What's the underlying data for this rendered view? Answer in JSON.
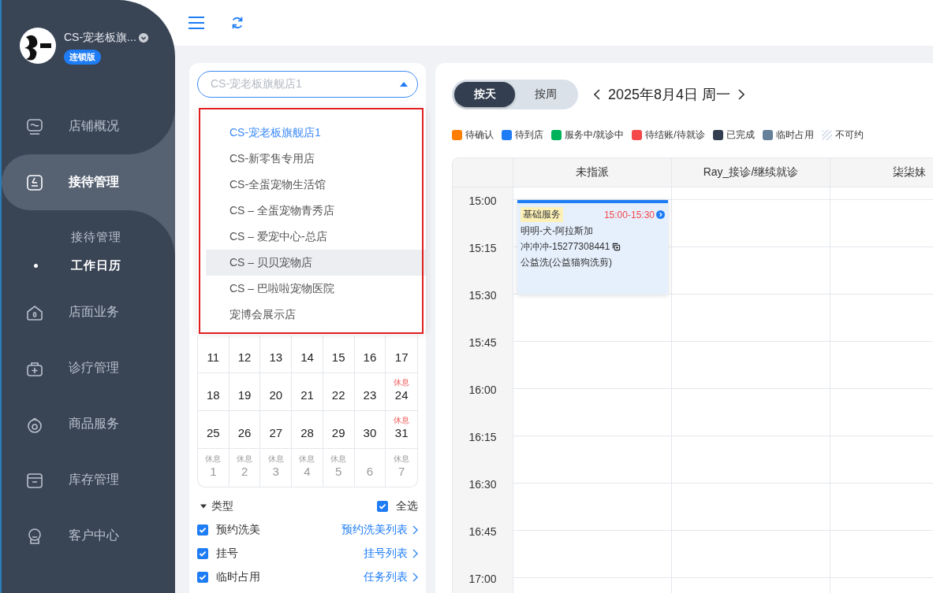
{
  "sidebar": {
    "brand": {
      "name": "CS-宠老板旗...",
      "badge": "连锁版"
    },
    "items": [
      {
        "label": "店铺概况",
        "selected": false
      },
      {
        "label": "接待管理",
        "selected": true,
        "expanded": true,
        "children": [
          {
            "label": "接待管理",
            "selected": false
          },
          {
            "label": "工作日历",
            "selected": true
          }
        ]
      },
      {
        "label": "店面业务",
        "selected": false
      },
      {
        "label": "诊疗管理",
        "selected": false
      },
      {
        "label": "商品服务",
        "selected": false
      },
      {
        "label": "库存管理",
        "selected": false
      },
      {
        "label": "客户中心",
        "selected": false
      }
    ]
  },
  "store_select": {
    "placeholder": "CS-宠老板旗舰店1",
    "open": true,
    "options": [
      {
        "label": "CS-宠老板旗舰店1",
        "selected": true,
        "hovered": false
      },
      {
        "label": "CS-新零售专用店",
        "selected": false,
        "hovered": false
      },
      {
        "label": "CS-全蛋宠物生活馆",
        "selected": false,
        "hovered": false
      },
      {
        "label": "CS – 全蛋宠物青秀店",
        "selected": false,
        "hovered": false
      },
      {
        "label": "CS – 爱宠中心-总店",
        "selected": false,
        "hovered": false
      },
      {
        "label": "CS – 贝贝宠物店",
        "selected": false,
        "hovered": true
      },
      {
        "label": "CS – 巴啦啦宠物医院",
        "selected": false,
        "hovered": false
      },
      {
        "label": "宠博会展示店",
        "selected": false,
        "hovered": false
      }
    ]
  },
  "calendar": {
    "weeks": [
      [
        {
          "day": "11",
          "muted": false
        },
        {
          "day": "12",
          "muted": false
        },
        {
          "day": "13",
          "muted": false
        },
        {
          "day": "14",
          "muted": false
        },
        {
          "day": "15",
          "muted": false
        },
        {
          "day": "16",
          "muted": false
        },
        {
          "day": "17",
          "muted": false
        }
      ],
      [
        {
          "day": "18",
          "muted": false
        },
        {
          "day": "19",
          "muted": false
        },
        {
          "day": "20",
          "muted": false
        },
        {
          "day": "21",
          "muted": false
        },
        {
          "day": "22",
          "muted": false
        },
        {
          "day": "23",
          "muted": false
        },
        {
          "day": "24",
          "muted": false,
          "note": "休息"
        }
      ],
      [
        {
          "day": "25",
          "muted": false
        },
        {
          "day": "26",
          "muted": false
        },
        {
          "day": "27",
          "muted": false
        },
        {
          "day": "28",
          "muted": false
        },
        {
          "day": "29",
          "muted": false
        },
        {
          "day": "30",
          "muted": false
        },
        {
          "day": "31",
          "muted": false,
          "note": "休息"
        }
      ],
      [
        {
          "day": "1",
          "muted": true,
          "note": "休息"
        },
        {
          "day": "2",
          "muted": true,
          "note": "休息"
        },
        {
          "day": "3",
          "muted": true,
          "note": "休息"
        },
        {
          "day": "4",
          "muted": true,
          "note": "休息"
        },
        {
          "day": "5",
          "muted": true,
          "note": "休息"
        },
        {
          "day": "6",
          "muted": true
        },
        {
          "day": "7",
          "muted": true,
          "note": "休息"
        }
      ]
    ]
  },
  "filters": {
    "title": "类型",
    "expanded": true,
    "select_all": {
      "label": "全选",
      "checked": true
    },
    "items": [
      {
        "label": "预约洗美",
        "checked": true,
        "link": "预约洗美列表"
      },
      {
        "label": "挂号",
        "checked": true,
        "link": "挂号列表"
      },
      {
        "label": "临时占用",
        "checked": true,
        "link": "任务列表"
      }
    ]
  },
  "view_toggle": [
    {
      "label": "按天",
      "selected": true
    },
    {
      "label": "按周",
      "selected": false
    }
  ],
  "date": "2025年8月4日 周一",
  "legend": [
    {
      "label": "待确认",
      "kind": "solid",
      "color": "#ff7d00"
    },
    {
      "label": "待到店",
      "kind": "solid",
      "color": "#1e7cf5"
    },
    {
      "label": "服务中/就诊中",
      "kind": "solid",
      "color": "#00b259"
    },
    {
      "label": "待结账/待就诊",
      "kind": "solid",
      "color": "#f5484a"
    },
    {
      "label": "已完成",
      "kind": "solid",
      "color": "#333f50"
    },
    {
      "label": "临时占用",
      "kind": "solid",
      "color": "#66809a"
    },
    {
      "label": "不可约",
      "kind": "hatched",
      "color": "#dde4ee"
    }
  ],
  "schedule": {
    "times": [
      "15:00",
      "15:15",
      "15:30",
      "15:45",
      "16:00",
      "16:15",
      "16:30",
      "16:45",
      "17:00"
    ],
    "columns": [
      {
        "name": "未指派",
        "events": [
          {
            "tag": "基础服务",
            "time": "15:00-15:30",
            "pet": "明明-犬-阿拉斯加",
            "owner": "冲冲冲-15277308441",
            "service": "公益洗(公益猫狗洗剪)"
          }
        ]
      },
      {
        "name": "Ray_接诊/继续就诊"
      },
      {
        "name": "柒柒妹"
      }
    ]
  }
}
